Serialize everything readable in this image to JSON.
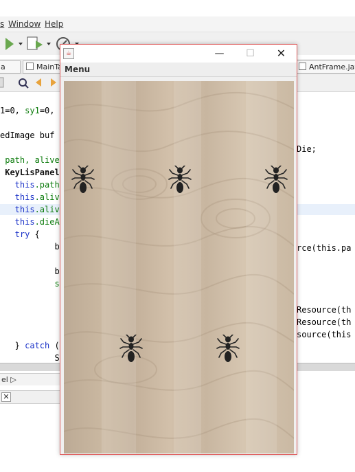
{
  "ide": {
    "menu": [
      "s",
      "Window",
      "Help"
    ],
    "tabs": [
      {
        "label": "a"
      },
      {
        "label": "MainTa"
      },
      {
        "label": "AntFrame.java"
      }
    ],
    "code_lines": [
      {
        "segments": [
          {
            "t": "1=0, ",
            "c": "normal"
          },
          {
            "t": "sy1",
            "c": "fld"
          },
          {
            "t": "=0, ",
            "c": "normal"
          }
        ]
      },
      {
        "segments": [
          {
            "t": "edImage buf",
            "c": "normal"
          },
          {
            "t": "",
            "c": "normal"
          }
        ]
      },
      {
        "segments": [
          {
            "t": " path, alive",
            "c": "fld"
          }
        ]
      },
      {
        "segments": [
          {
            "t": " KeyLisPanel",
            "c": "bold"
          }
        ]
      },
      {
        "segments": [
          {
            "t": "   this",
            "c": "kw"
          },
          {
            "t": ".path",
            "c": "fld"
          }
        ]
      },
      {
        "segments": [
          {
            "t": "   this",
            "c": "kw"
          },
          {
            "t": ".alive",
            "c": "fld"
          }
        ]
      },
      {
        "segments": [
          {
            "t": "   this",
            "c": "kw"
          },
          {
            "t": ".alive",
            "c": "fld"
          }
        ]
      },
      {
        "segments": [
          {
            "t": "   this",
            "c": "kw"
          },
          {
            "t": ".dieAn",
            "c": "fld"
          }
        ]
      },
      {
        "segments": [
          {
            "t": "   try",
            "c": "kw"
          },
          {
            "t": " {",
            "c": "normal"
          }
        ]
      },
      {
        "segments": [
          {
            "t": "           bu",
            "c": "normal"
          }
        ]
      },
      {
        "segments": [
          {
            "t": "           bu",
            "c": "normal"
          }
        ]
      },
      {
        "segments": [
          {
            "t": "           sy",
            "c": "fld"
          }
        ]
      },
      {
        "segments": [
          {
            "t": "            b",
            "c": "normal"
          }
        ]
      },
      {
        "segments": [
          {
            "t": "            b",
            "c": "normal"
          }
        ]
      },
      {
        "segments": [
          {
            "t": "   } ",
            "c": "normal"
          },
          {
            "t": "catch",
            "c": "kw"
          },
          {
            "t": " (I",
            "c": "normal"
          }
        ]
      },
      {
        "segments": [
          {
            "t": "           Sy",
            "c": "normal"
          }
        ]
      }
    ],
    "code_right": [
      {
        "text": "Die;",
        "row": 3
      },
      {
        "text": "rce(this.pa",
        "row": 11
      },
      {
        "text": "Resource(th",
        "row": 16
      },
      {
        "text": "Resource(th",
        "row": 17
      },
      {
        "text": "source(this",
        "row": 18
      }
    ],
    "breadcrumb": "el"
  },
  "frame": {
    "menu_label": "Menu",
    "ants": [
      {
        "id": "ant-1"
      },
      {
        "id": "ant-2"
      },
      {
        "id": "ant-3"
      },
      {
        "id": "ant-4"
      },
      {
        "id": "ant-5"
      }
    ]
  }
}
